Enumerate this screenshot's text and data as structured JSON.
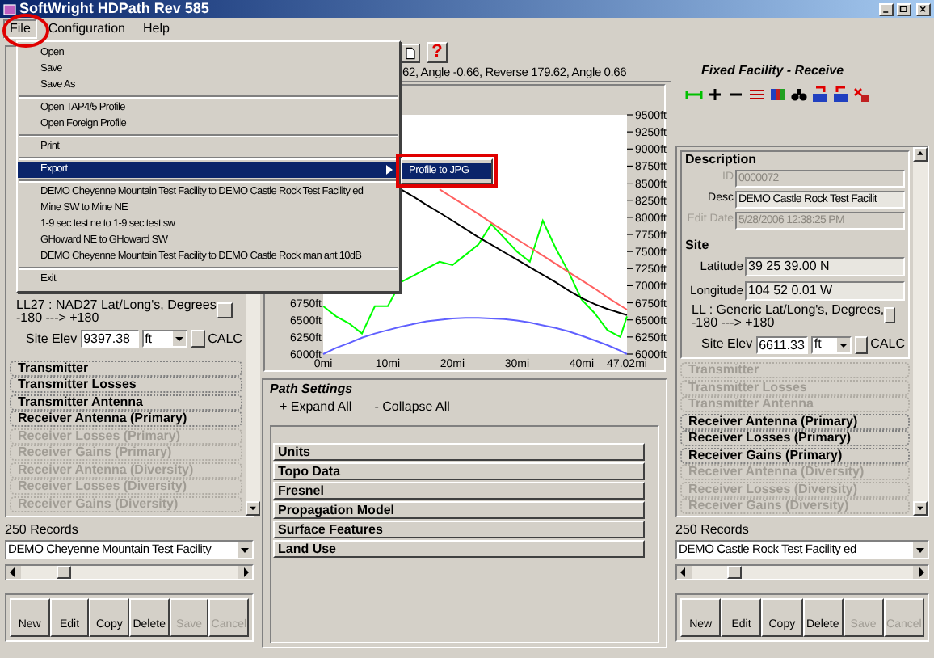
{
  "window": {
    "title": "SoftWright HDPath Rev 585"
  },
  "menu_bar": [
    {
      "label": "File",
      "selected": true
    },
    {
      "label": "Configuration",
      "selected": false
    },
    {
      "label": "Help",
      "selected": false
    }
  ],
  "file_menu": [
    {
      "kind": "item",
      "label": "Open",
      "selected": false
    },
    {
      "kind": "item",
      "label": "Save",
      "selected": false
    },
    {
      "kind": "item",
      "label": "Save As",
      "selected": false
    },
    {
      "kind": "separator"
    },
    {
      "kind": "item",
      "label": "Open TAP4/5 Profile",
      "selected": false
    },
    {
      "kind": "item",
      "label": "Open Foreign Profile",
      "selected": false
    },
    {
      "kind": "separator"
    },
    {
      "kind": "item",
      "label": "Print",
      "selected": false
    },
    {
      "kind": "separator"
    },
    {
      "kind": "submenu",
      "label": "Export",
      "selected": true
    },
    {
      "kind": "separator"
    },
    {
      "kind": "item",
      "label": "DEMO Cheyenne Mountain Test Facility to DEMO Castle Rock Test Facility ed",
      "selected": false
    },
    {
      "kind": "item",
      "label": "Mine SW to Mine NE",
      "selected": false
    },
    {
      "kind": "item",
      "label": "1-9 sec test ne to 1-9 sec test sw",
      "selected": false
    },
    {
      "kind": "item",
      "label": "GHoward NE to GHoward SW",
      "selected": false
    },
    {
      "kind": "item",
      "label": "DEMO Cheyenne Mountain Test Facility to DEMO Castle Rock man ant 10dB",
      "selected": false
    },
    {
      "kind": "separator"
    },
    {
      "kind": "item",
      "label": "Exit",
      "selected": false
    }
  ],
  "export_submenu": [
    {
      "label": "Profile to JPG",
      "selected": true
    }
  ],
  "left_panel": {
    "coord_system": [
      "LL27 : NAD27 Lat/Long's, Degrees",
      "-180 ---> +180"
    ],
    "site_elev": {
      "label": "Site Elev",
      "value": "9397.38",
      "unit": "ft",
      "calc": "CALC"
    },
    "sections": [
      {
        "label": "Transmitter",
        "disabled": false
      },
      {
        "label": "Transmitter Losses",
        "disabled": false
      },
      {
        "label": "Transmitter Antenna",
        "disabled": false
      },
      {
        "label": "Receiver Antenna (Primary)",
        "disabled": false
      },
      {
        "label": "Receiver Losses (Primary)",
        "disabled": true
      },
      {
        "label": "Receiver Gains (Primary)",
        "disabled": true
      },
      {
        "label": "Receiver Antenna (Diversity)",
        "disabled": true
      },
      {
        "label": "Receiver Losses (Diversity)",
        "disabled": true
      },
      {
        "label": "Receiver Gains (Diversity)",
        "disabled": true
      }
    ],
    "records": "250 Records",
    "facility": "DEMO Cheyenne Mountain Test Facility",
    "buttons": [
      {
        "label": "New",
        "disabled": false
      },
      {
        "label": "Edit",
        "disabled": false
      },
      {
        "label": "Copy",
        "disabled": false
      },
      {
        "label": "Delete",
        "disabled": false
      },
      {
        "label": "Save",
        "disabled": true
      },
      {
        "label": "Cancel",
        "disabled": true
      }
    ]
  },
  "center": {
    "help": "?",
    "status": "62, Angle -0.66, Reverse 179.62, Angle 0.66",
    "chart": {
      "left_axis_labels": [
        "6750ft",
        "6500ft",
        "6250ft",
        "6000ft"
      ],
      "chart_data": {
        "type": "line",
        "x": [
          0,
          2,
          4,
          6,
          8,
          10,
          12,
          14,
          16,
          18,
          20,
          22,
          24,
          26,
          28,
          30,
          32,
          34,
          36,
          38,
          40,
          42,
          44,
          46,
          47.02
        ],
        "xlim": [
          0,
          47.02
        ],
        "ylim": [
          6000,
          9500
        ],
        "xticks": [
          {
            "value": 0,
            "label": "0mi"
          },
          {
            "value": 10,
            "label": "10mi"
          },
          {
            "value": 20,
            "label": "20mi"
          },
          {
            "value": 30,
            "label": "30mi"
          },
          {
            "value": 40,
            "label": "40mi"
          },
          {
            "value": 47.02,
            "label": "47.02mi"
          }
        ],
        "yticks": [
          {
            "value": 9500,
            "label": "9500ft"
          },
          {
            "value": 9250,
            "label": "9250ft"
          },
          {
            "value": 9000,
            "label": "9000ft"
          },
          {
            "value": 8750,
            "label": "8750ft"
          },
          {
            "value": 8500,
            "label": "8500ft"
          },
          {
            "value": 8250,
            "label": "8250ft"
          },
          {
            "value": 8000,
            "label": "8000ft"
          },
          {
            "value": 7750,
            "label": "7750ft"
          },
          {
            "value": 7500,
            "label": "7500ft"
          },
          {
            "value": 7250,
            "label": "7250ft"
          },
          {
            "value": 7000,
            "label": "7000ft"
          },
          {
            "value": 6750,
            "label": "6750ft"
          },
          {
            "value": 6500,
            "label": "6500ft"
          },
          {
            "value": 6250,
            "label": "6250ft"
          },
          {
            "value": 6000,
            "label": "6000ft"
          }
        ],
        "series": [
          {
            "color": "#00ff00",
            "values": [
              6700,
              6550,
              6450,
              6300,
              6700,
              6700,
              7050,
              7150,
              7250,
              7350,
              7300,
              7450,
              7600,
              7900,
              7700,
              7500,
              7350,
              7950,
              7550,
              7200,
              6800,
              6600,
              6350,
              6250,
              6550
            ]
          },
          {
            "color": "#ff6060",
            "values": [
              null,
              null,
              null,
              null,
              null,
              null,
              null,
              null,
              null,
              8410,
              8290,
              8170,
              8050,
              7920,
              7800,
              7680,
              7560,
              7440,
              7320,
              7200,
              7080,
              6960,
              6830,
              6710,
              6650
            ]
          },
          {
            "color": "#000000",
            "values": [
              null,
              null,
              null,
              null,
              null,
              null,
              8410,
              8300,
              8180,
              8070,
              7950,
              7830,
              7710,
              7600,
              7490,
              7380,
              7270,
              7160,
              7050,
              6930,
              6820,
              6730,
              6660,
              6600,
              6570
            ]
          },
          {
            "color": "#6060ff",
            "values": [
              6000,
              6090,
              6160,
              6240,
              6300,
              6350,
              6400,
              6440,
              6480,
              6500,
              6520,
              6530,
              6530,
              6520,
              6510,
              6490,
              6460,
              6420,
              6380,
              6330,
              6270,
              6200,
              6130,
              6050,
              6000
            ]
          }
        ]
      }
    },
    "path_settings": {
      "title": "Path Settings",
      "expand": "+ Expand All",
      "collapse": "- Collapse All",
      "sections": [
        "Units",
        "Topo Data",
        "Fresnel",
        "Propagation Model",
        "Surface Features",
        "Land Use"
      ]
    }
  },
  "right_panel": {
    "title": "Fixed Facility - Receive",
    "description": {
      "title": "Description",
      "fields": [
        {
          "label": "ID",
          "value": "0000072",
          "disabled": true
        },
        {
          "label": "Desc",
          "value": "DEMO Castle Rock Test Facilit",
          "disabled": false
        },
        {
          "label": "Edit Date",
          "value": "5/28/2006 12:38:25 PM",
          "disabled": true
        }
      ]
    },
    "site": {
      "title": "Site",
      "fields": [
        {
          "label": "Latitude",
          "value": "39 25 39.00 N"
        },
        {
          "label": "Longitude",
          "value": "104 52 0.01 W"
        }
      ],
      "coord_system": [
        "LL : Generic Lat/Long's, Degrees,",
        "-180 ---> +180"
      ],
      "site_elev": {
        "label": "Site Elev",
        "value": "6611.33",
        "unit": "ft",
        "calc": "CALC"
      }
    },
    "sections": [
      {
        "label": "Transmitter",
        "disabled": true
      },
      {
        "label": "Transmitter Losses",
        "disabled": true
      },
      {
        "label": "Transmitter Antenna",
        "disabled": true
      },
      {
        "label": "Receiver Antenna (Primary)",
        "disabled": false
      },
      {
        "label": "Receiver Losses (Primary)",
        "disabled": false
      },
      {
        "label": "Receiver Gains (Primary)",
        "disabled": false
      },
      {
        "label": "Receiver Antenna (Diversity)",
        "disabled": true
      },
      {
        "label": "Receiver Losses (Diversity)",
        "disabled": true
      },
      {
        "label": "Receiver Gains (Diversity)",
        "disabled": true
      }
    ],
    "records": "250 Records",
    "facility": "DEMO Castle Rock Test Facility ed",
    "buttons": [
      {
        "label": "New",
        "disabled": false
      },
      {
        "label": "Edit",
        "disabled": false
      },
      {
        "label": "Copy",
        "disabled": false
      },
      {
        "label": "Delete",
        "disabled": false
      },
      {
        "label": "Save",
        "disabled": true
      },
      {
        "label": "Cancel",
        "disabled": true
      }
    ]
  }
}
